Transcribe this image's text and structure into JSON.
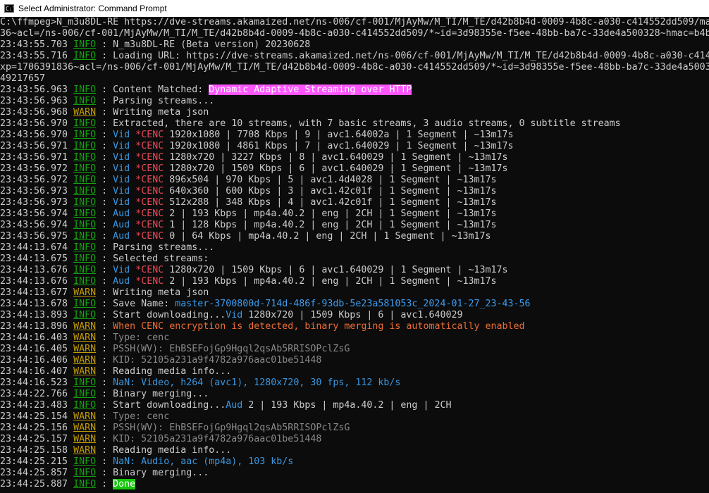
{
  "window": {
    "title": "Select Administrator: Command Prompt",
    "icon_text": "C:\\"
  },
  "lines": [
    [
      {
        "t": "C:\\ffmpeg>N_m3u8DL-RE https://dve-streams.akamaized.net/ns-006/cf-001/MjAyMw/M_TI/M_TE/d42b8b4d-0009-4b8c-a030-c414552dd509/ma"
      }
    ],
    [
      {
        "t": "36~acl=/ns-006/cf-001/MjAyMw/M_TI/M_TE/d42b8b4d-0009-4b8c-a030-c414552dd509/*~id=3d98355e-f5ee-48bb-ba7c-33de4a500328~hmac=b4b"
      }
    ],
    [
      {
        "t": "23:43:55.703 "
      },
      {
        "t": "INFO",
        "c": "info"
      },
      {
        "t": " : N_m3u8DL-RE (Beta version) 20230628"
      }
    ],
    [
      {
        "t": "23:43:55.716 "
      },
      {
        "t": "INFO",
        "c": "info"
      },
      {
        "t": " : Loading URL: https://dve-streams.akamaized.net/ns-006/cf-001/MjAyMw/M_TI/M_TE/d42b8b4d-0009-4b8c-a030-c414"
      }
    ],
    [
      {
        "t": "xp=1706391836~acl=/ns-006/cf-001/MjAyMw/M_TI/M_TE/d42b8b4d-0009-4b8c-a030-c414552dd509/*~id=3d98355e-f5ee-48bb-ba7c-33de4a5003"
      }
    ],
    [
      {
        "t": "49217657"
      }
    ],
    [
      {
        "t": "23:43:56.963 "
      },
      {
        "t": "INFO",
        "c": "info"
      },
      {
        "t": " : Content Matched: "
      },
      {
        "t": "Dynamic Adaptive Streaming over HTTP",
        "c": "hl-magenta"
      }
    ],
    [
      {
        "t": "23:43:56.963 "
      },
      {
        "t": "INFO",
        "c": "info"
      },
      {
        "t": " : Parsing streams..."
      }
    ],
    [
      {
        "t": "23:43:56.968 "
      },
      {
        "t": "WARN",
        "c": "warn"
      },
      {
        "t": " : Writing meta json"
      }
    ],
    [
      {
        "t": "23:43:56.970 "
      },
      {
        "t": "INFO",
        "c": "info"
      },
      {
        "t": " : Extracted, there are 10 streams, with 7 basic streams, 3 audio streams, 0 subtitle streams"
      }
    ],
    [
      {
        "t": "23:43:56.970 "
      },
      {
        "t": "INFO",
        "c": "info"
      },
      {
        "t": " : "
      },
      {
        "t": "Vid",
        "c": "cyan"
      },
      {
        "t": " "
      },
      {
        "t": "*CENC",
        "c": "red"
      },
      {
        "t": " 1920x1080 | 7708 Kbps | 9 | avc1.64002a | 1 Segment | ~13m17s"
      }
    ],
    [
      {
        "t": "23:43:56.971 "
      },
      {
        "t": "INFO",
        "c": "info"
      },
      {
        "t": " : "
      },
      {
        "t": "Vid",
        "c": "cyan"
      },
      {
        "t": " "
      },
      {
        "t": "*CENC",
        "c": "red"
      },
      {
        "t": " 1920x1080 | 4861 Kbps | 7 | avc1.640029 | 1 Segment | ~13m17s"
      }
    ],
    [
      {
        "t": "23:43:56.971 "
      },
      {
        "t": "INFO",
        "c": "info"
      },
      {
        "t": " : "
      },
      {
        "t": "Vid",
        "c": "cyan"
      },
      {
        "t": " "
      },
      {
        "t": "*CENC",
        "c": "red"
      },
      {
        "t": " 1280x720 | 3227 Kbps | 8 | avc1.640029 | 1 Segment | ~13m17s"
      }
    ],
    [
      {
        "t": "23:43:56.972 "
      },
      {
        "t": "INFO",
        "c": "info"
      },
      {
        "t": " : "
      },
      {
        "t": "Vid",
        "c": "cyan"
      },
      {
        "t": " "
      },
      {
        "t": "*CENC",
        "c": "red"
      },
      {
        "t": " 1280x720 | 1509 Kbps | 6 | avc1.640029 | 1 Segment | ~13m17s"
      }
    ],
    [
      {
        "t": "23:43:56.972 "
      },
      {
        "t": "INFO",
        "c": "info"
      },
      {
        "t": " : "
      },
      {
        "t": "Vid",
        "c": "cyan"
      },
      {
        "t": " "
      },
      {
        "t": "*CENC",
        "c": "red"
      },
      {
        "t": " 896x504 | 970 Kbps | 5 | avc1.4d4028 | 1 Segment | ~13m17s"
      }
    ],
    [
      {
        "t": "23:43:56.973 "
      },
      {
        "t": "INFO",
        "c": "info"
      },
      {
        "t": " : "
      },
      {
        "t": "Vid",
        "c": "cyan"
      },
      {
        "t": " "
      },
      {
        "t": "*CENC",
        "c": "red"
      },
      {
        "t": " 640x360 | 600 Kbps | 3 | avc1.42c01f | 1 Segment | ~13m17s"
      }
    ],
    [
      {
        "t": "23:43:56.973 "
      },
      {
        "t": "INFO",
        "c": "info"
      },
      {
        "t": " : "
      },
      {
        "t": "Vid",
        "c": "cyan"
      },
      {
        "t": " "
      },
      {
        "t": "*CENC",
        "c": "red"
      },
      {
        "t": " 512x288 | 348 Kbps | 4 | avc1.42c01f | 1 Segment | ~13m17s"
      }
    ],
    [
      {
        "t": "23:43:56.974 "
      },
      {
        "t": "INFO",
        "c": "info"
      },
      {
        "t": " : "
      },
      {
        "t": "Aud",
        "c": "cyan"
      },
      {
        "t": " "
      },
      {
        "t": "*CENC",
        "c": "red"
      },
      {
        "t": " 2 | 193 Kbps | mp4a.40.2 | eng | 2CH | 1 Segment | ~13m17s"
      }
    ],
    [
      {
        "t": "23:43:56.974 "
      },
      {
        "t": "INFO",
        "c": "info"
      },
      {
        "t": " : "
      },
      {
        "t": "Aud",
        "c": "cyan"
      },
      {
        "t": " "
      },
      {
        "t": "*CENC",
        "c": "red"
      },
      {
        "t": " 1 | 128 Kbps | mp4a.40.2 | eng | 2CH | 1 Segment | ~13m17s"
      }
    ],
    [
      {
        "t": "23:43:56.975 "
      },
      {
        "t": "INFO",
        "c": "info"
      },
      {
        "t": " : "
      },
      {
        "t": "Aud",
        "c": "cyan"
      },
      {
        "t": " "
      },
      {
        "t": "*CENC",
        "c": "red"
      },
      {
        "t": " 0 | 64 Kbps | mp4a.40.2 | eng | 2CH | 1 Segment | ~13m17s"
      }
    ],
    [
      {
        "t": "23:44:13.674 "
      },
      {
        "t": "INFO",
        "c": "info"
      },
      {
        "t": " : Parsing streams..."
      }
    ],
    [
      {
        "t": "23:44:13.675 "
      },
      {
        "t": "INFO",
        "c": "info"
      },
      {
        "t": " : Selected streams:"
      }
    ],
    [
      {
        "t": "23:44:13.676 "
      },
      {
        "t": "INFO",
        "c": "info"
      },
      {
        "t": " : "
      },
      {
        "t": "Vid",
        "c": "cyan"
      },
      {
        "t": " "
      },
      {
        "t": "*CENC",
        "c": "red"
      },
      {
        "t": " 1280x720 | 1509 Kbps | 6 | avc1.640029 | 1 Segment | ~13m17s"
      }
    ],
    [
      {
        "t": "23:44:13.676 "
      },
      {
        "t": "INFO",
        "c": "info"
      },
      {
        "t": " : "
      },
      {
        "t": "Aud",
        "c": "cyan"
      },
      {
        "t": " "
      },
      {
        "t": "*CENC",
        "c": "red"
      },
      {
        "t": " 2 | 193 Kbps | mp4a.40.2 | eng | 2CH | 1 Segment | ~13m17s"
      }
    ],
    [
      {
        "t": "23:44:13.677 "
      },
      {
        "t": "WARN",
        "c": "warn"
      },
      {
        "t": " : Writing meta json"
      }
    ],
    [
      {
        "t": "23:44:13.678 "
      },
      {
        "t": "INFO",
        "c": "info"
      },
      {
        "t": " : Save Name: "
      },
      {
        "t": "master-3700800d-714d-486f-93db-5e23a581053c_2024-01-27_23-43-56",
        "c": "blue"
      }
    ],
    [
      {
        "t": "23:44:13.893 "
      },
      {
        "t": "INFO",
        "c": "info"
      },
      {
        "t": " : Start downloading..."
      },
      {
        "t": "Vid",
        "c": "cyan"
      },
      {
        "t": " 1280x720 | 1509 Kbps | 6 | avc1.640029"
      }
    ],
    [
      {
        "t": "23:44:13.896 "
      },
      {
        "t": "WARN",
        "c": "warn"
      },
      {
        "t": " : "
      },
      {
        "t": "When CENC encryption is detected, binary merging is automatically enabled",
        "c": "orange"
      }
    ],
    [
      {
        "t": "23:44:16.403 "
      },
      {
        "t": "WARN",
        "c": "warn"
      },
      {
        "t": " : "
      },
      {
        "t": "Type: cenc",
        "c": "gray"
      }
    ],
    [
      {
        "t": "23:44:16.405 "
      },
      {
        "t": "WARN",
        "c": "warn"
      },
      {
        "t": " : "
      },
      {
        "t": "PSSH(WV): EhBSEFojGp9Hgql2qsAb5RRISOPclZsG",
        "c": "gray"
      }
    ],
    [
      {
        "t": "23:44:16.406 "
      },
      {
        "t": "WARN",
        "c": "warn"
      },
      {
        "t": " : "
      },
      {
        "t": "KID: 52105a231a9f4782a976aac01be51448",
        "c": "gray"
      }
    ],
    [
      {
        "t": "23:44:16.407 "
      },
      {
        "t": "WARN",
        "c": "warn"
      },
      {
        "t": " : Reading media info..."
      }
    ],
    [
      {
        "t": "23:44:16.523 "
      },
      {
        "t": "INFO",
        "c": "info"
      },
      {
        "t": " : "
      },
      {
        "t": "NaN: Video, h264 (avc1), 1280x720, 30 fps, 112 kb/s",
        "c": "cyan"
      }
    ],
    [
      {
        "t": "23:44:22.766 "
      },
      {
        "t": "INFO",
        "c": "info"
      },
      {
        "t": " : Binary merging..."
      }
    ],
    [
      {
        "t": "23:44:23.483 "
      },
      {
        "t": "INFO",
        "c": "info"
      },
      {
        "t": " : Start downloading..."
      },
      {
        "t": "Aud",
        "c": "cyan"
      },
      {
        "t": " 2 | 193 Kbps | mp4a.40.2 | eng | 2CH"
      }
    ],
    [
      {
        "t": "23:44:25.154 "
      },
      {
        "t": "WARN",
        "c": "warn"
      },
      {
        "t": " : "
      },
      {
        "t": "Type: cenc",
        "c": "gray"
      }
    ],
    [
      {
        "t": "23:44:25.156 "
      },
      {
        "t": "WARN",
        "c": "warn"
      },
      {
        "t": " : "
      },
      {
        "t": "PSSH(WV): EhBSEFojGp9Hgql2qsAb5RRISOPclZsG",
        "c": "gray"
      }
    ],
    [
      {
        "t": "23:44:25.157 "
      },
      {
        "t": "WARN",
        "c": "warn"
      },
      {
        "t": " : "
      },
      {
        "t": "KID: 52105a231a9f4782a976aac01be51448",
        "c": "gray"
      }
    ],
    [
      {
        "t": "23:44:25.158 "
      },
      {
        "t": "WARN",
        "c": "warn"
      },
      {
        "t": " : Reading media info..."
      }
    ],
    [
      {
        "t": "23:44:25.215 "
      },
      {
        "t": "INFO",
        "c": "info"
      },
      {
        "t": " : "
      },
      {
        "t": "NaN: Audio, aac (mp4a), 103 kb/s",
        "c": "cyan"
      }
    ],
    [
      {
        "t": "23:44:25.857 "
      },
      {
        "t": "INFO",
        "c": "info"
      },
      {
        "t": " : Binary merging..."
      }
    ],
    [
      {
        "t": "23:44:25.887 "
      },
      {
        "t": "INFO",
        "c": "info"
      },
      {
        "t": " : "
      },
      {
        "t": "Done",
        "c": "hl-green"
      }
    ]
  ]
}
